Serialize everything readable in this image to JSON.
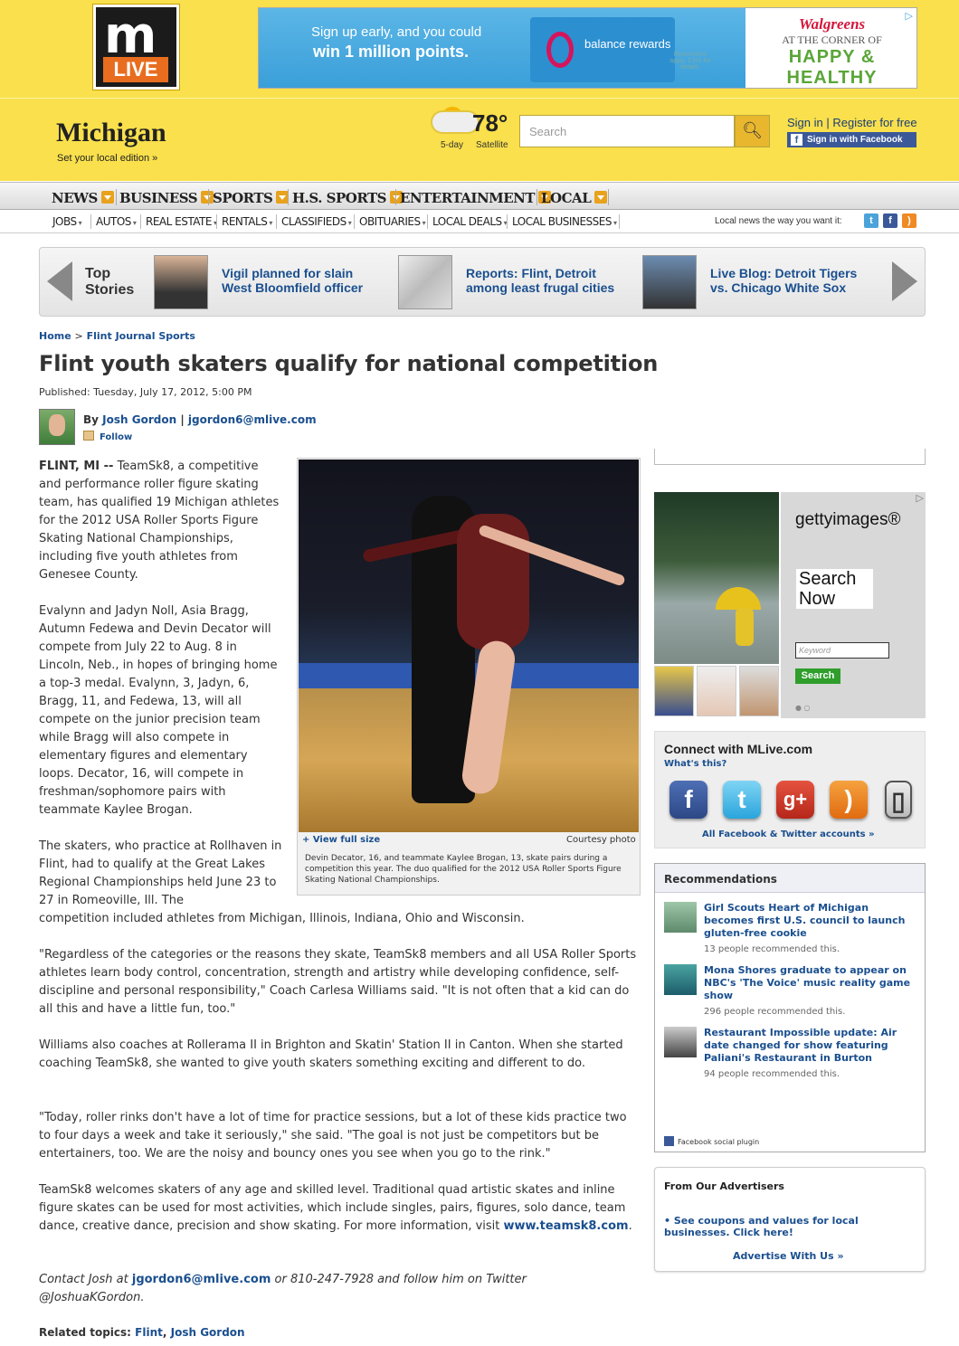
{
  "header": {
    "logo_top": "m",
    "logo_bottom": "LIVE",
    "ad": {
      "line1": "Sign up early, and you could",
      "line2": "win 1 million points.",
      "card_brand": "balance rewards",
      "restrictions": "Restrictions apply. Click for details.",
      "brand": "Walgreens",
      "tagline1": "AT THE CORNER OF",
      "tagline2": "HAPPY & HEALTHY"
    },
    "state": "Michigan",
    "set_local": "Set your local edition »",
    "weather": {
      "temp": "78°",
      "five_day": "5-day",
      "satellite": "Satellite"
    },
    "search_placeholder": "Search",
    "sign_in": "Sign in | Register for free",
    "fb_sign_in": "Sign in with Facebook"
  },
  "nav_primary": [
    "NEWS",
    "BUSINESS",
    "SPORTS",
    "H.S. SPORTS",
    "ENTERTAINMENT",
    "LOCAL"
  ],
  "nav_secondary": [
    "JOBS",
    "AUTOS",
    "REAL ESTATE",
    "RENTALS",
    "CLASSIFIEDS",
    "OBITUARIES",
    "LOCAL DEALS",
    "LOCAL BUSINESSES"
  ],
  "local_news_text": "Local news the way you want it:",
  "top_stories": {
    "label": "Top Stories",
    "items": [
      {
        "title": "Vigil planned for slain West Bloomfield officer"
      },
      {
        "title": "Reports: Flint, Detroit among least frugal cities"
      },
      {
        "title": "Live Blog: Detroit Tigers vs. Chicago White Sox"
      }
    ]
  },
  "breadcrumb": {
    "home": "Home",
    "sep": ">",
    "section": "Flint Journal Sports"
  },
  "article": {
    "headline": "Flint youth skaters qualify for national competition",
    "published": "Published: Tuesday, July 17, 2012, 5:00 PM",
    "byline_prefix": "By",
    "author": "Josh Gordon",
    "byline_sep": "|",
    "author_email": "jgordon6@mlive.com",
    "follow": "Follow",
    "dateline": "FLINT, MI --",
    "p1": "TeamSk8, a competitive and performance roller figure skating team, has qualified 19 Michigan athletes for the 2012 USA Roller Sports Figure Skating National Championships, including five youth athletes from Genesee County.",
    "p2": "Evalynn and Jadyn Noll, Asia Bragg, Autumn Fedewa and Devin Decator will compete from July 22 to Aug. 8 in Lincoln, Neb., in hopes of bringing home a top-3 medal. Evalynn, 3, Jadyn, 6, Bragg, 11, and Fedewa, 13, will all compete on the junior precision team while Bragg will also compete in elementary figures and elementary loops. Decator, 16, will compete in freshman/sophomore pairs with teammate Kaylee Brogan.",
    "p3a": "The skaters, who practice at Rollhaven in Flint, had to qualify at the Great Lakes Regional Championships held June 23 to 27 in Romeoville, Ill. The",
    "p3b": "competition included athletes from Michigan, Illinois, Indiana, Ohio and Wisconsin.",
    "p4": "\"Regardless of the categories or the reasons they skate, TeamSk8 members and all USA Roller Sports athletes learn body control, concentration, strength and artistry while developing confidence, self-discipline and personal responsibility,\" Coach Carlesa Williams said. \"It is not often that a kid can do all this and have a little fun, too.\"",
    "p5": "Williams also coaches at Rollerama II in Brighton and Skatin' Station II in Canton. When she started coaching TeamSk8, she wanted to give youth skaters something exciting and different to do.",
    "p6": "\"Today, roller rinks don't have a lot of time for practice sessions, but a lot of these kids practice two to four days a week and take it seriously,\" she said. \"The goal is not just be competitors but be entertainers, too. We are the noisy and bouncy ones you see when you go to the rink.\"",
    "p7": "TeamSk8 welcomes skaters of any age and skilled level. Traditional quad artistic skates and inline figure skates can be used for most activities, which include singles, pairs, figures, solo dance, team dance, creative dance, precision and show skating. For more information, visit",
    "p7_link": "www.teamsk8.com",
    "contact_prefix": "Contact Josh at",
    "contact_email": "jgordon6@mlive.com",
    "contact_suffix": "or 810-247-7928 and follow him on Twitter @JoshuaKGordon.",
    "related_label": "Related topics:",
    "related_1": "Flint",
    "related_2": "Josh Gordon"
  },
  "photo": {
    "view_full": "+ View full size",
    "credit": "Courtesy photo",
    "caption": "Devin Decator, 16, and teammate Kaylee Brogan, 13, skate pairs during a competition this year. The duo qualified for the 2012 USA Roller Sports Figure Skating National Championships."
  },
  "getty_ad": {
    "logo": "gettyimages®",
    "search_now": "Search Now",
    "keyword_placeholder": "Keyword",
    "search_button": "Search"
  },
  "connect": {
    "title": "Connect with MLive.com",
    "whats_this": "What's this?",
    "all_accounts": "All Facebook & Twitter accounts »"
  },
  "recommendations": {
    "title": "Recommendations",
    "items": [
      {
        "title": "Girl Scouts Heart of Michigan becomes first U.S. council to launch gluten-free cookie",
        "count": "13 people recommended this."
      },
      {
        "title": "Mona Shores graduate to appear on NBC's 'The Voice' music reality game show",
        "count": "296 people recommended this."
      },
      {
        "title": "Restaurant Impossible update: Air date changed for show featuring Paliani's Restaurant in Burton",
        "count": "94 people recommended this."
      }
    ],
    "plugin": "Facebook social plugin"
  },
  "advertisers": {
    "title": "From Our Advertisers",
    "coupons": "• See coupons and values for local businesses. Click here!",
    "advertise": "Advertise With Us »"
  }
}
